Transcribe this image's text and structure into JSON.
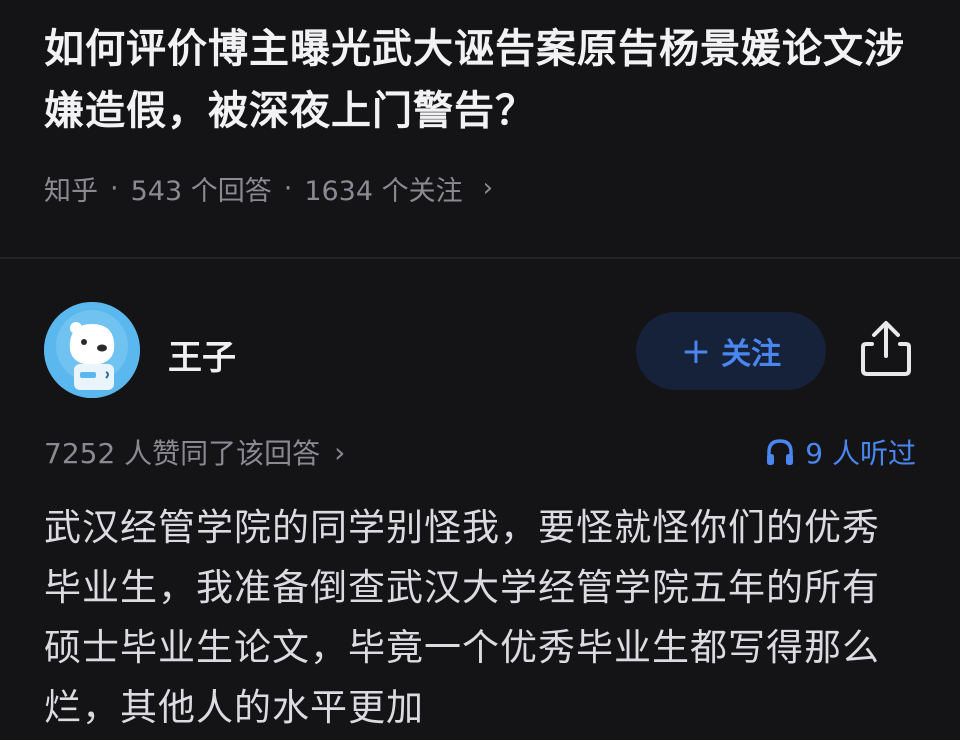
{
  "question": {
    "title": "如何评价博主曝光武大诬告案原告杨景媛论文涉嫌造假，被深夜上门警告？",
    "source": "知乎",
    "separator": "·",
    "answer_count": "543 个回答",
    "follow_count": "1634 个关注",
    "chevron": "›"
  },
  "author": {
    "name": "王子",
    "avatar_icon": "polar-bear-astronaut-avatar",
    "follow_label": "关注",
    "follow_plus": "+",
    "share_icon": "share-icon"
  },
  "stats": {
    "votes": "7252 人赞同了该回答",
    "votes_chevron": "›",
    "listens": "9 人听过",
    "listen_icon": "headphones-icon"
  },
  "answer": {
    "text": "武汉经管学院的同学别怪我，要怪就怪你们的优秀毕业生，我准备倒查武汉大学经管学院五年的所有硕士毕业生论文，毕竟一个优秀毕业生都写得那么烂，其他人的水平更加"
  },
  "colors": {
    "background": "#141417",
    "accent": "#4a86f0",
    "muted": "#8a8a92",
    "follow_bg": "#16223a"
  }
}
